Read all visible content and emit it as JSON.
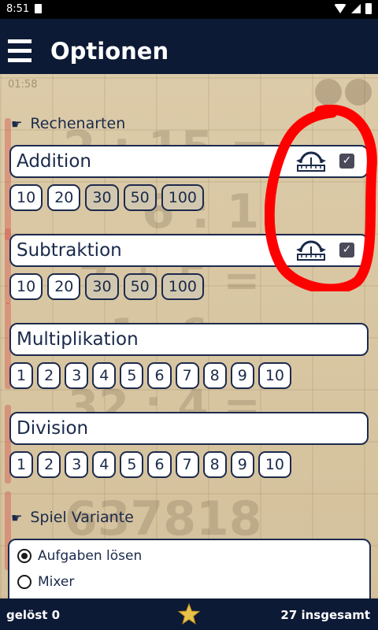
{
  "status": {
    "time": "8:51"
  },
  "app": {
    "title": "Optionen"
  },
  "timer": "01:58",
  "sections": {
    "rechenarten": "Rechenarten",
    "spiel_variante": "Spiel Variante"
  },
  "operations": {
    "addition": {
      "label": "Addition",
      "checked": true,
      "chips": [
        "10",
        "20",
        "30",
        "50",
        "100"
      ],
      "chips_off": [
        "30",
        "50",
        "100"
      ]
    },
    "subtraktion": {
      "label": "Subtraktion",
      "checked": true,
      "chips": [
        "10",
        "20",
        "30",
        "50",
        "100"
      ],
      "chips_off": [
        "30",
        "50",
        "100"
      ]
    },
    "multiplikation": {
      "label": "Multiplikation",
      "chips": [
        "1",
        "2",
        "3",
        "4",
        "5",
        "6",
        "7",
        "8",
        "9",
        "10"
      ]
    },
    "division": {
      "label": "Division",
      "chips": [
        "1",
        "2",
        "3",
        "4",
        "5",
        "6",
        "7",
        "8",
        "9",
        "10"
      ]
    }
  },
  "variant": {
    "options": [
      "Aufgaben lösen",
      "Mixer"
    ],
    "selected": "Aufgaben lösen"
  },
  "background_numbers": [
    "2 : 15 =",
    "6 : 1",
    "7 + 5 =",
    "1 · 6",
    "32 : 4 =",
    "637818"
  ],
  "bottom": {
    "solved": "gelöst 0",
    "total": "27 insgesamt"
  },
  "icons": {
    "menu": "hamburger-icon",
    "mode": "gauge-ruler-icon",
    "star": "star-icon",
    "hand": "pointing-hand-icon"
  },
  "colors": {
    "appbar": "#0d1a36",
    "annotation": "#ff0000",
    "border": "#1c2a4c"
  }
}
